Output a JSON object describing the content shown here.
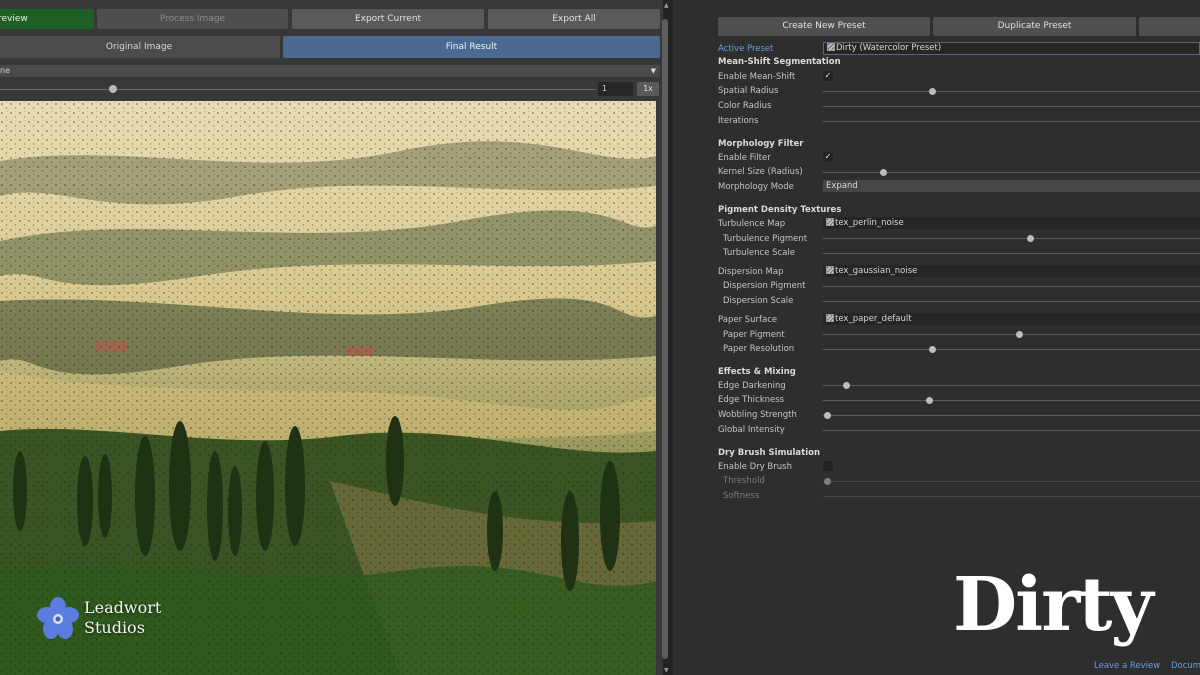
{
  "toolbar": {
    "preview_label": "review",
    "process_label": "Process Image",
    "export_current_label": "Export Current",
    "export_all_label": "Export All"
  },
  "view_tabs": {
    "original_label": "Original Image",
    "final_label": "Final Result"
  },
  "display": {
    "mode_value": "ne",
    "zoom_value": "1",
    "zoom_reset_label": "1x",
    "zoom_level": 0.19
  },
  "logo": {
    "line1": "Leadwort",
    "line2": "Studios",
    "flower_color": "#5b7de0"
  },
  "preset_buttons": {
    "create_label": "Create New Preset",
    "duplicate_label": "Duplicate Preset"
  },
  "inspector": {
    "active_preset_label": "Active Preset",
    "active_preset_value": "Dirty (Watercolor Preset)",
    "mean_shift": {
      "title": "Mean-Shift Segmentation",
      "enable_label": "Enable Mean-Shift",
      "enabled": true,
      "spatial_radius_label": "Spatial Radius",
      "spatial_radius_level": 0.29,
      "color_radius_label": "Color Radius",
      "iterations_label": "Iterations"
    },
    "morphology": {
      "title": "Morphology Filter",
      "enable_label": "Enable Filter",
      "enabled": true,
      "kernel_label": "Kernel Size (Radius)",
      "kernel_level": 0.16,
      "mode_label": "Morphology Mode",
      "mode_value": "Expand"
    },
    "pigment": {
      "title": "Pigment Density Textures",
      "turbulence_map_label": "Turbulence Map",
      "turbulence_map_value": "tex_perlin_noise",
      "turbulence_pigment_label": "Turbulence Pigment",
      "turbulence_pigment_level": 0.55,
      "turbulence_scale_label": "Turbulence Scale",
      "dispersion_map_label": "Dispersion Map",
      "dispersion_map_value": "tex_gaussian_noise",
      "dispersion_pigment_label": "Dispersion Pigment",
      "dispersion_scale_label": "Dispersion Scale",
      "paper_surface_label": "Paper Surface",
      "paper_surface_value": "tex_paper_default",
      "paper_pigment_label": "Paper Pigment",
      "paper_pigment_level": 0.52,
      "paper_resolution_label": "Paper Resolution",
      "paper_resolution_level": 0.29
    },
    "effects": {
      "title": "Effects & Mixing",
      "edge_darkening_label": "Edge Darkening",
      "edge_darkening_level": 0.06,
      "edge_thickness_label": "Edge Thickness",
      "edge_thickness_level": 0.28,
      "wobbling_label": "Wobbling Strength",
      "wobbling_level": 0.01,
      "global_intensity_label": "Global Intensity"
    },
    "dry_brush": {
      "title": "Dry Brush Simulation",
      "enable_label": "Enable Dry Brush",
      "enabled": false,
      "threshold_label": "Threshold",
      "threshold_level": 0.01,
      "softness_label": "Softness"
    }
  },
  "overlay_title": "Dirty",
  "footer": {
    "leave_review": "Leave a Review",
    "docs": "Docume"
  },
  "colors": {
    "preview_button": "#1f5f24",
    "active_tab": "#4a6a92",
    "link": "#6b9ce0"
  }
}
